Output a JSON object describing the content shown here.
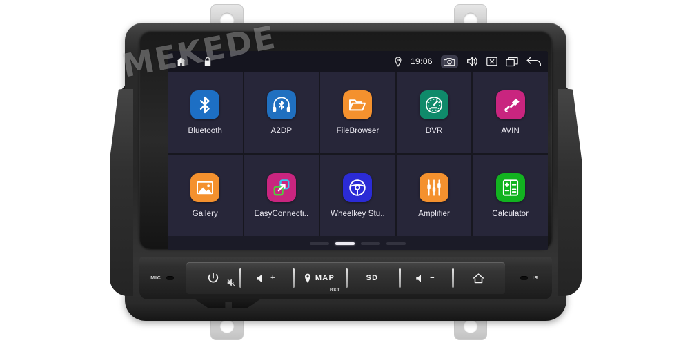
{
  "device": {
    "watermark": "MEKEDE",
    "brand_mark_name": "mekede-watermark"
  },
  "statusbar": {
    "home_icon": "home-icon",
    "lock_icon": "lock-icon",
    "location_icon": "location-pin-icon",
    "time": "19:06",
    "camera_icon": "camera-icon",
    "volume_icon": "speaker-volume-icon",
    "close_icon": "close-box-icon",
    "recents_icon": "recent-apps-icon",
    "back_icon": "back-arrow-icon",
    "background": "#15151f"
  },
  "apps": [
    {
      "label": "Bluetooth",
      "icon": "bluetooth-icon",
      "color": "#1d6fc4"
    },
    {
      "label": "A2DP",
      "icon": "a2dp-headset-icon",
      "color": "#2070c0"
    },
    {
      "label": "FileBrowser",
      "icon": "folder-icon",
      "color": "#f4912e"
    },
    {
      "label": "DVR",
      "icon": "speedometer-icon",
      "color": "#0f8a6a"
    },
    {
      "label": "AVIN",
      "icon": "audio-plug-icon",
      "color": "#c9257f"
    },
    {
      "label": "Gallery",
      "icon": "image-icon",
      "color": "#f4912e"
    },
    {
      "label": "EasyConnecti..",
      "icon": "easyconnect-icon",
      "color": "#c9257f"
    },
    {
      "label": "Wheelkey Stu..",
      "icon": "steering-wheel-icon",
      "color": "#2b2bd6"
    },
    {
      "label": "Amplifier",
      "icon": "equalizer-icon",
      "color": "#f4912e"
    },
    {
      "label": "Calculator",
      "icon": "calculator-icon",
      "color": "#12b320"
    }
  ],
  "pager": {
    "count": 4,
    "active_index": 1
  },
  "hardware": {
    "mic_label": "MIC",
    "ir_label": "IR",
    "power_icon": "power-icon",
    "mute_icon": "mute-icon",
    "volume_up_label": "+",
    "volume_up_icon": "speaker-icon",
    "map_label": "MAP",
    "map_icon": "location-pin-icon",
    "rst_label": "RST",
    "sd_label": "SD",
    "volume_down_label": "−",
    "volume_down_icon": "speaker-icon",
    "home_icon": "home-icon"
  },
  "theme": {
    "tile_bg": "#272639",
    "screen_bg": "#1a1a26",
    "grid_gap": "#17171f",
    "text": "#eceaf2"
  }
}
